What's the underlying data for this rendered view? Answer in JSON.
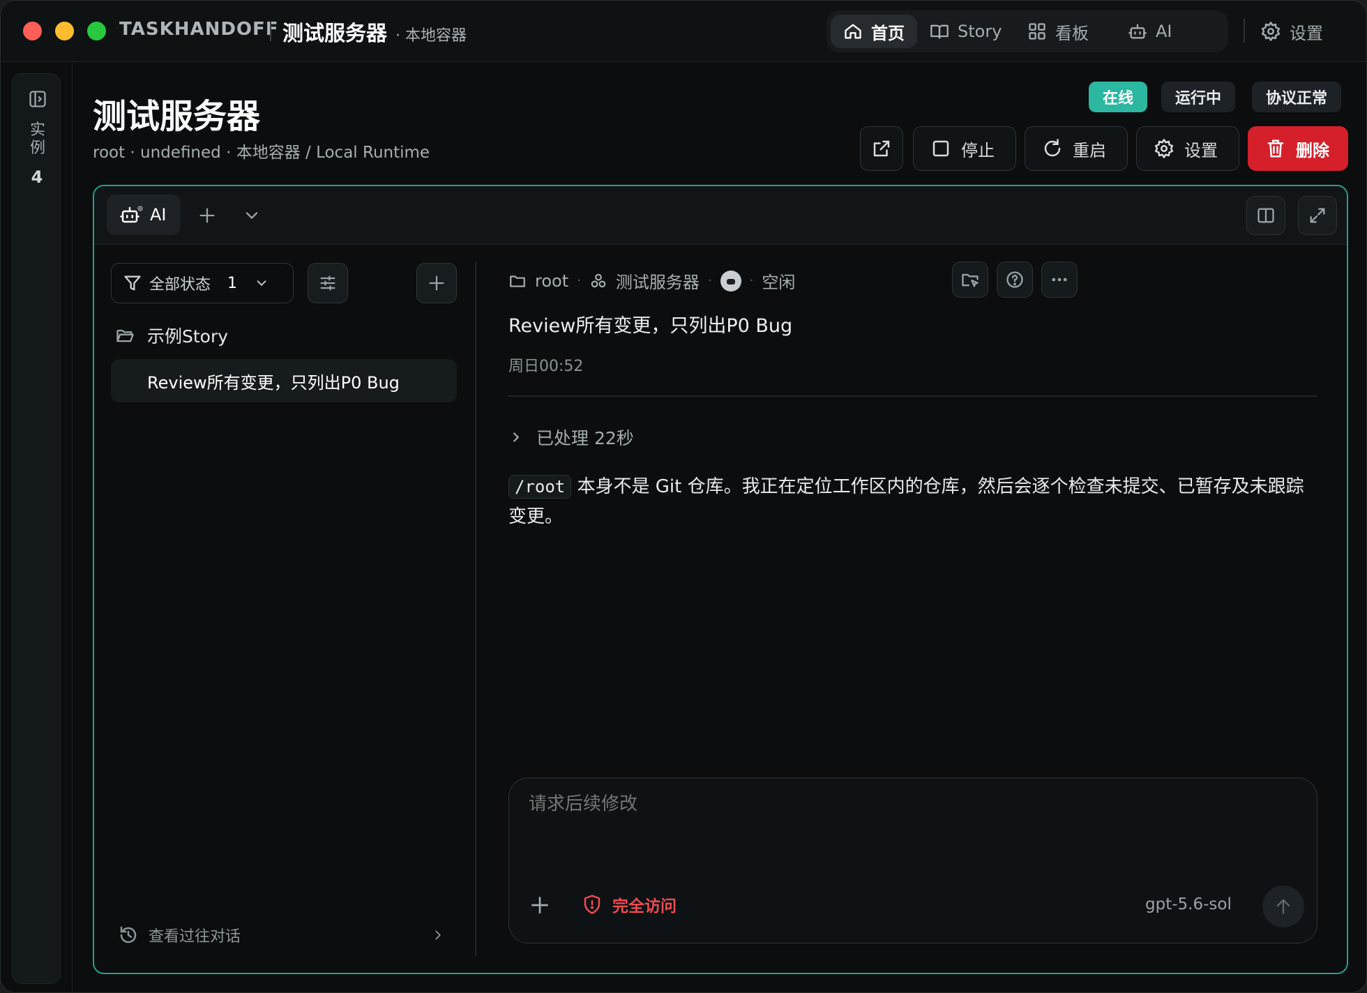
{
  "titlebar": {
    "app_name": "TASKHANDOFF",
    "title": "测试服务器",
    "subtitle": "· 本地容器"
  },
  "topnav": {
    "items": [
      {
        "label": "首页",
        "icon": "home-icon",
        "active": true
      },
      {
        "label": "Story",
        "icon": "book-icon",
        "active": false
      },
      {
        "label": "看板",
        "icon": "grid-icon",
        "active": false
      },
      {
        "label": "AI",
        "icon": "robot-icon",
        "active": false
      }
    ],
    "settings_label": "设置"
  },
  "rail": {
    "label": "实例",
    "count": "4"
  },
  "header": {
    "title": "测试服务器",
    "meta": "root · undefined · 本地容器 / Local Runtime",
    "badges": {
      "online": "在线",
      "running": "运行中",
      "protocol": "协议正常"
    },
    "buttons": {
      "stop": "停止",
      "restart": "重启",
      "settings": "设置",
      "delete": "删除"
    }
  },
  "panel": {
    "tab_label": "AI"
  },
  "sidebar": {
    "filter_label": "全部状态",
    "filter_count": "1",
    "folder_label": "示例Story",
    "story_item": "Review所有变更，只列出P0 Bug",
    "history_label": "查看过往对话"
  },
  "conversation": {
    "crumb_folder": "root",
    "crumb_server": "测试服务器",
    "crumb_status": "空闲",
    "title": "Review所有变更，只列出P0 Bug",
    "time": "周日00:52",
    "processed": "已处理 22秒",
    "answer_code": "/root",
    "answer_text": " 本身不是 Git 仓库。我正在定位工作区内的仓库，然后会逐个检查未提交、已暂存及未跟踪变更。"
  },
  "composer": {
    "placeholder": "请求后续修改",
    "access_label": "完全访问",
    "model": "gpt-5.6-sol"
  },
  "colors": {
    "accent": "#2bb7a0",
    "danger": "#d51f2a",
    "access_red": "#ef4b52"
  }
}
